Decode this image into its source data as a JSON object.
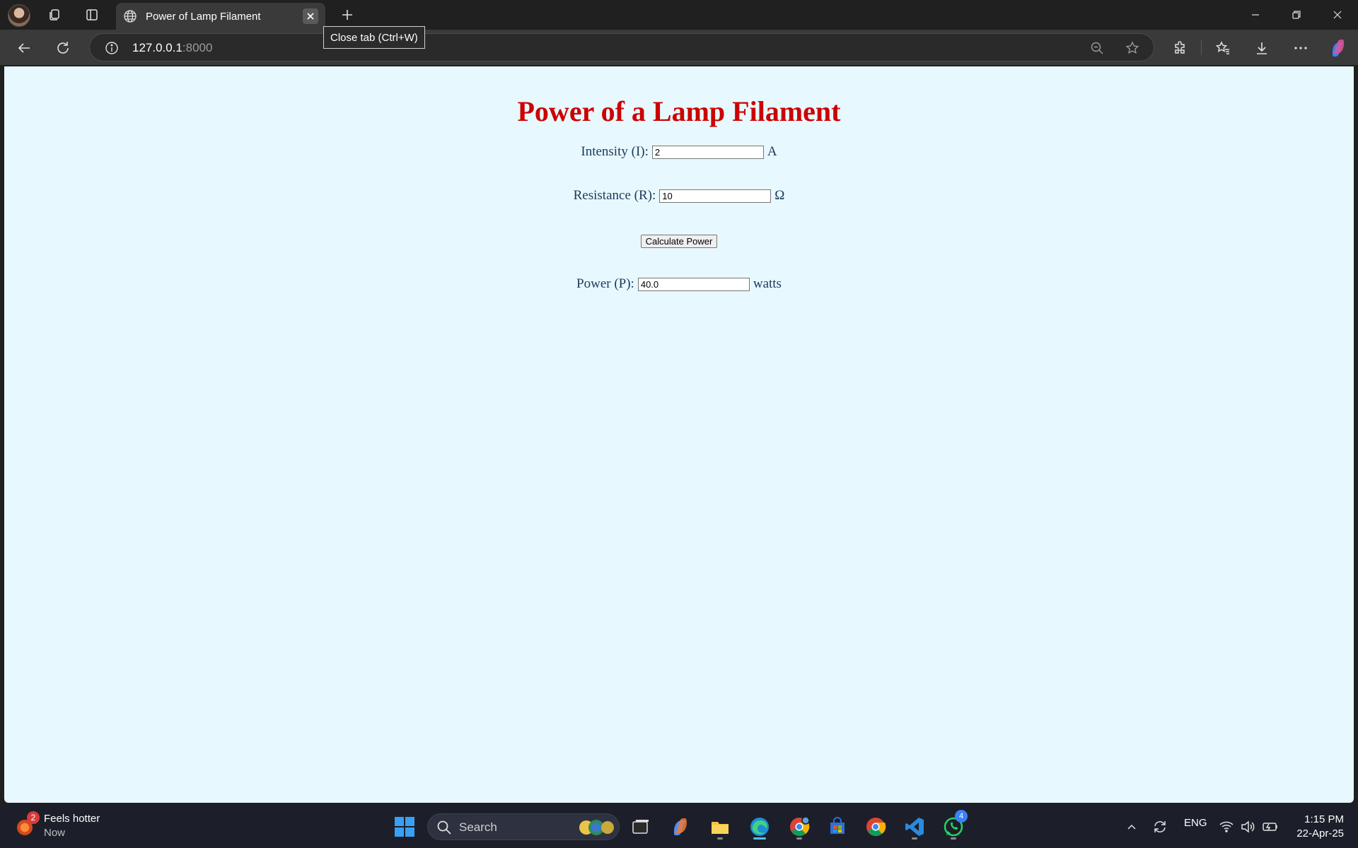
{
  "browser": {
    "tab_title": "Power of Lamp Filament",
    "tooltip": "Close tab (Ctrl+W)",
    "url_host": "127.0.0.1",
    "url_port": ":8000"
  },
  "page": {
    "title": "Power of a Lamp Filament",
    "intensity": {
      "label": "Intensity (I):",
      "value": "2",
      "unit": "A"
    },
    "resistance": {
      "label": "Resistance (R):",
      "value": "10",
      "unit": "Ω"
    },
    "calculate_label": "Calculate Power",
    "power": {
      "label": "Power (P):",
      "value": "40.0",
      "unit": "watts"
    }
  },
  "taskbar": {
    "weather_title": "Feels hotter",
    "weather_sub": "Now",
    "weather_badge": "2",
    "search_placeholder": "Search",
    "whatsapp_badge": "4",
    "lang": "ENG",
    "time": "1:15 PM",
    "date": "22-Apr-25"
  }
}
